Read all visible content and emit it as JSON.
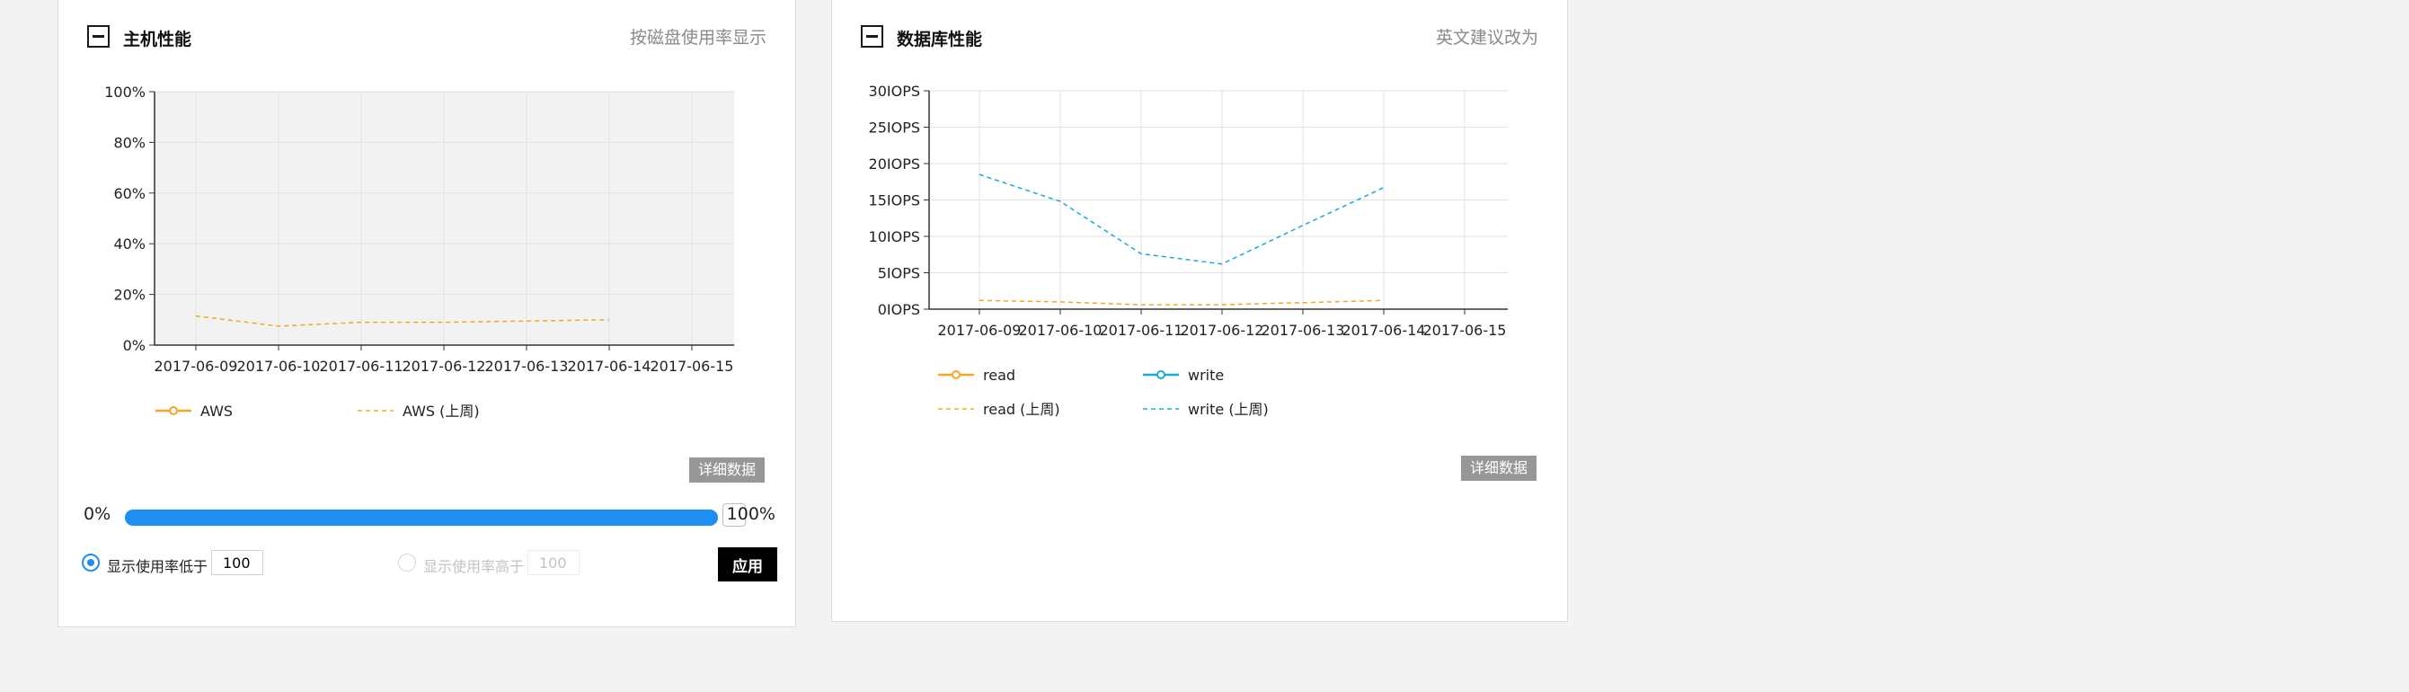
{
  "host_panel": {
    "title": "主机性能",
    "hint": "按磁盘使用率显示",
    "detail_button": "详细数据",
    "range": {
      "min_label": "0%",
      "max_label": "100%",
      "value_fraction": 1.0
    },
    "filter_low": {
      "label": "显示使用率低于",
      "value": "100",
      "selected": true
    },
    "filter_high": {
      "label": "显示使用率高于",
      "value": "100",
      "selected": false
    },
    "apply_button": "应用"
  },
  "db_panel": {
    "title": "数据库性能",
    "hint": "英文建议改为",
    "detail_button": "详细数据"
  },
  "chart_data": [
    {
      "type": "line",
      "x": [
        "2017-06-09",
        "2017-06-10",
        "2017-06-11",
        "2017-06-12",
        "2017-06-13",
        "2017-06-14",
        "2017-06-15"
      ],
      "y_ticks": [
        "0%",
        "20%",
        "40%",
        "60%",
        "80%",
        "100%"
      ],
      "ylim": [
        0,
        100
      ],
      "grid": true,
      "legend_position": "bottom-left",
      "series": [
        {
          "name": "AWS",
          "style": "solid-marker",
          "color": "#f5a623",
          "values": [
            null,
            null,
            null,
            null,
            null,
            null,
            null
          ]
        },
        {
          "name": "AWS (上周)",
          "style": "dashed",
          "color": "#f5a623",
          "values": [
            11.5,
            7.5,
            9,
            9,
            9.5,
            10,
            null
          ]
        }
      ]
    },
    {
      "type": "line",
      "x": [
        "2017-06-09",
        "2017-06-10",
        "2017-06-11",
        "2017-06-12",
        "2017-06-13",
        "2017-06-14",
        "2017-06-15"
      ],
      "y_ticks": [
        "0IOPS",
        "5IOPS",
        "10IOPS",
        "15IOPS",
        "20IOPS",
        "25IOPS",
        "30IOPS"
      ],
      "ylim": [
        0,
        30
      ],
      "grid": true,
      "legend_position": "bottom-left",
      "series": [
        {
          "name": "read",
          "style": "solid-marker",
          "color": "#f5a623",
          "values": [
            null,
            null,
            null,
            null,
            null,
            null,
            null
          ]
        },
        {
          "name": "write",
          "style": "solid-marker",
          "color": "#1aaad8",
          "values": [
            null,
            null,
            null,
            null,
            null,
            null,
            null
          ]
        },
        {
          "name": "read (上周)",
          "style": "dashed",
          "color": "#f5a623",
          "values": [
            1.2,
            1,
            0.6,
            0.6,
            0.9,
            1.2,
            null
          ]
        },
        {
          "name": "write (上周)",
          "style": "dashed",
          "color": "#1aaad8",
          "values": [
            18.5,
            14.8,
            7.6,
            6.2,
            11.5,
            16.7,
            null
          ]
        }
      ]
    }
  ]
}
